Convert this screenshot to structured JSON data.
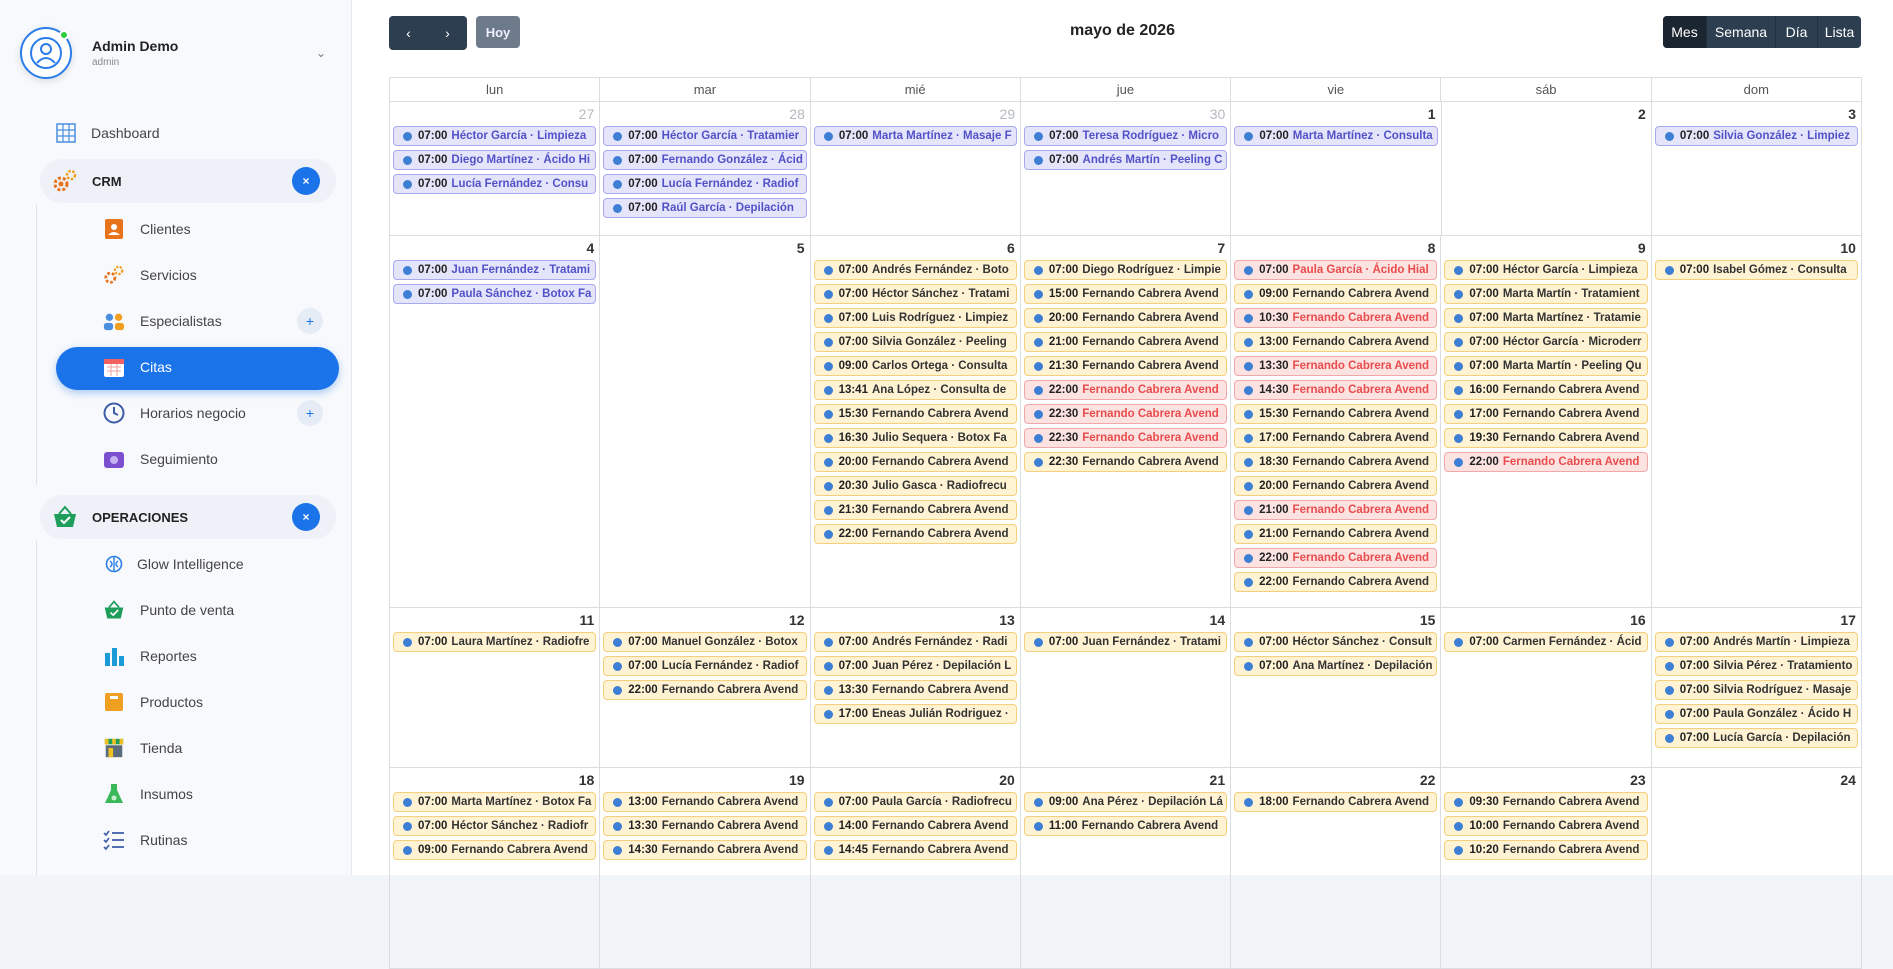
{
  "user": {
    "name": "Admin Demo",
    "role": "admin"
  },
  "nav": {
    "dashboard": "Dashboard",
    "crm_section": "CRM",
    "crm_items": [
      "Clientes",
      "Servicios",
      "Especialistas",
      "Citas",
      "Horarios negocio",
      "Seguimiento"
    ],
    "ops_section": "OPERACIONES",
    "ops_items": [
      "Glow Intelligence",
      "Punto de venta",
      "Reportes",
      "Productos",
      "Tienda",
      "Insumos",
      "Rutinas"
    ]
  },
  "toolbar": {
    "prev": "‹",
    "next": "›",
    "today": "Hoy",
    "title": "mayo de 2026",
    "views": [
      "Mes",
      "Semana",
      "Día",
      "Lista"
    ],
    "active_view": "Mes"
  },
  "weekdays": [
    "lun",
    "mar",
    "mié",
    "jue",
    "vie",
    "sáb",
    "dom"
  ],
  "weeks": [
    {
      "days": [
        {
          "n": "27",
          "other": true,
          "events": [
            {
              "time": "07:00",
              "text": "Héctor García · Limpieza",
              "kind": "purple"
            },
            {
              "time": "07:00",
              "text": "Diego Martínez · Ácido Hi",
              "kind": "purple"
            },
            {
              "time": "07:00",
              "text": "Lucía Fernández · Consu",
              "kind": "purple"
            }
          ]
        },
        {
          "n": "28",
          "other": true,
          "events": [
            {
              "time": "07:00",
              "text": "Héctor García · Tratamier",
              "kind": "purple"
            },
            {
              "time": "07:00",
              "text": "Fernando González · Ácid",
              "kind": "purple"
            },
            {
              "time": "07:00",
              "text": "Lucía Fernández · Radiof",
              "kind": "purple"
            },
            {
              "time": "07:00",
              "text": "Raúl García · Depilación",
              "kind": "purple"
            }
          ]
        },
        {
          "n": "29",
          "other": true,
          "events": [
            {
              "time": "07:00",
              "text": "Marta Martínez · Masaje F",
              "kind": "purple"
            }
          ]
        },
        {
          "n": "30",
          "other": true,
          "events": [
            {
              "time": "07:00",
              "text": "Teresa Rodríguez · Micro",
              "kind": "purple"
            },
            {
              "time": "07:00",
              "text": "Andrés Martín · Peeling C",
              "kind": "purple"
            }
          ]
        },
        {
          "n": "1",
          "events": [
            {
              "time": "07:00",
              "text": "Marta Martínez · Consulta",
              "kind": "purple"
            }
          ]
        },
        {
          "n": "2",
          "events": []
        },
        {
          "n": "3",
          "events": [
            {
              "time": "07:00",
              "text": "Silvia González · Limpiez",
              "kind": "purple"
            }
          ]
        }
      ]
    },
    {
      "days": [
        {
          "n": "4",
          "events": [
            {
              "time": "07:00",
              "text": "Juan Fernández · Tratami",
              "kind": "purple"
            },
            {
              "time": "07:00",
              "text": "Paula Sánchez · Botox Fa",
              "kind": "purple"
            }
          ]
        },
        {
          "n": "5",
          "events": []
        },
        {
          "n": "6",
          "events": [
            {
              "time": "07:00",
              "text": "Andrés Fernández · Boto",
              "kind": "yellow"
            },
            {
              "time": "07:00",
              "text": "Héctor Sánchez · Tratami",
              "kind": "yellow"
            },
            {
              "time": "07:00",
              "text": "Luis Rodríguez · Limpiez",
              "kind": "yellow"
            },
            {
              "time": "07:00",
              "text": "Silvia González · Peeling",
              "kind": "yellow"
            },
            {
              "time": "09:00",
              "text": "Carlos Ortega · Consulta",
              "kind": "yellow"
            },
            {
              "time": "13:41",
              "text": "Ana López · Consulta de",
              "kind": "yellow"
            },
            {
              "time": "15:30",
              "text": "Fernando Cabrera Avend",
              "kind": "yellow"
            },
            {
              "time": "16:30",
              "text": "Julio Sequera · Botox Fa",
              "kind": "yellow"
            },
            {
              "time": "20:00",
              "text": "Fernando Cabrera Avend",
              "kind": "yellow"
            },
            {
              "time": "20:30",
              "text": "Julio Gasca · Radiofrecu",
              "kind": "yellow"
            },
            {
              "time": "21:30",
              "text": "Fernando Cabrera Avend",
              "kind": "yellow"
            },
            {
              "time": "22:00",
              "text": "Fernando Cabrera Avend",
              "kind": "yellow"
            }
          ]
        },
        {
          "n": "7",
          "events": [
            {
              "time": "07:00",
              "text": "Diego Rodríguez · Limpie",
              "kind": "yellow"
            },
            {
              "time": "15:00",
              "text": "Fernando Cabrera Avend",
              "kind": "yellow"
            },
            {
              "time": "20:00",
              "text": "Fernando Cabrera Avend",
              "kind": "yellow"
            },
            {
              "time": "21:00",
              "text": "Fernando Cabrera Avend",
              "kind": "yellow"
            },
            {
              "time": "21:30",
              "text": "Fernando Cabrera Avend",
              "kind": "yellow"
            },
            {
              "time": "22:00",
              "text": "Fernando Cabrera Avend",
              "kind": "red"
            },
            {
              "time": "22:30",
              "text": "Fernando Cabrera Avend",
              "kind": "red"
            },
            {
              "time": "22:30",
              "text": "Fernando Cabrera Avend",
              "kind": "red"
            },
            {
              "time": "22:30",
              "text": "Fernando Cabrera Avend",
              "kind": "yellow"
            }
          ]
        },
        {
          "n": "8",
          "events": [
            {
              "time": "07:00",
              "text": "Paula García · Ácido Hial",
              "kind": "red"
            },
            {
              "time": "09:00",
              "text": "Fernando Cabrera Avend",
              "kind": "yellow"
            },
            {
              "time": "10:30",
              "text": "Fernando Cabrera Avend",
              "kind": "red"
            },
            {
              "time": "13:00",
              "text": "Fernando Cabrera Avend",
              "kind": "yellow"
            },
            {
              "time": "13:30",
              "text": "Fernando Cabrera Avend",
              "kind": "red"
            },
            {
              "time": "14:30",
              "text": "Fernando Cabrera Avend",
              "kind": "red"
            },
            {
              "time": "15:30",
              "text": "Fernando Cabrera Avend",
              "kind": "yellow"
            },
            {
              "time": "17:00",
              "text": "Fernando Cabrera Avend",
              "kind": "yellow"
            },
            {
              "time": "18:30",
              "text": "Fernando Cabrera Avend",
              "kind": "yellow"
            },
            {
              "time": "20:00",
              "text": "Fernando Cabrera Avend",
              "kind": "yellow"
            },
            {
              "time": "21:00",
              "text": "Fernando Cabrera Avend",
              "kind": "red"
            },
            {
              "time": "21:00",
              "text": "Fernando Cabrera Avend",
              "kind": "yellow"
            },
            {
              "time": "22:00",
              "text": "Fernando Cabrera Avend",
              "kind": "red"
            },
            {
              "time": "22:00",
              "text": "Fernando Cabrera Avend",
              "kind": "yellow"
            }
          ]
        },
        {
          "n": "9",
          "events": [
            {
              "time": "07:00",
              "text": "Héctor García · Limpieza",
              "kind": "yellow"
            },
            {
              "time": "07:00",
              "text": "Marta Martín · Tratamient",
              "kind": "yellow"
            },
            {
              "time": "07:00",
              "text": "Marta Martínez · Tratamie",
              "kind": "yellow"
            },
            {
              "time": "07:00",
              "text": "Héctor García · Microderr",
              "kind": "yellow"
            },
            {
              "time": "07:00",
              "text": "Marta Martín · Peeling Qu",
              "kind": "yellow"
            },
            {
              "time": "16:00",
              "text": "Fernando Cabrera Avend",
              "kind": "yellow"
            },
            {
              "time": "17:00",
              "text": "Fernando Cabrera Avend",
              "kind": "yellow"
            },
            {
              "time": "19:30",
              "text": "Fernando Cabrera Avend",
              "kind": "yellow"
            },
            {
              "time": "22:00",
              "text": "Fernando Cabrera Avend",
              "kind": "red"
            }
          ]
        },
        {
          "n": "10",
          "events": [
            {
              "time": "07:00",
              "text": "Isabel Gómez · Consulta",
              "kind": "yellow"
            }
          ]
        }
      ]
    },
    {
      "days": [
        {
          "n": "11",
          "events": [
            {
              "time": "07:00",
              "text": "Laura Martínez · Radiofre",
              "kind": "yellow"
            }
          ]
        },
        {
          "n": "12",
          "events": [
            {
              "time": "07:00",
              "text": "Manuel González · Botox",
              "kind": "yellow"
            },
            {
              "time": "07:00",
              "text": "Lucía Fernández · Radiof",
              "kind": "yellow"
            },
            {
              "time": "22:00",
              "text": "Fernando Cabrera Avend",
              "kind": "yellow"
            }
          ]
        },
        {
          "n": "13",
          "events": [
            {
              "time": "07:00",
              "text": "Andrés Fernández · Radi",
              "kind": "yellow"
            },
            {
              "time": "07:00",
              "text": "Juan Pérez · Depilación L",
              "kind": "yellow"
            },
            {
              "time": "13:30",
              "text": "Fernando Cabrera Avend",
              "kind": "yellow"
            },
            {
              "time": "17:00",
              "text": "Eneas Julián Rodriguez ·",
              "kind": "yellow"
            }
          ]
        },
        {
          "n": "14",
          "events": [
            {
              "time": "07:00",
              "text": "Juan Fernández · Tratami",
              "kind": "yellow"
            }
          ]
        },
        {
          "n": "15",
          "events": [
            {
              "time": "07:00",
              "text": "Héctor Sánchez · Consult",
              "kind": "yellow"
            },
            {
              "time": "07:00",
              "text": "Ana Martínez · Depilación",
              "kind": "yellow"
            }
          ]
        },
        {
          "n": "16",
          "events": [
            {
              "time": "07:00",
              "text": "Carmen Fernández · Ácid",
              "kind": "yellow"
            }
          ]
        },
        {
          "n": "17",
          "events": [
            {
              "time": "07:00",
              "text": "Andrés Martín · Limpieza",
              "kind": "yellow"
            },
            {
              "time": "07:00",
              "text": "Silvia Pérez · Tratamiento",
              "kind": "yellow"
            },
            {
              "time": "07:00",
              "text": "Silvia Rodríguez · Masaje",
              "kind": "yellow"
            },
            {
              "time": "07:00",
              "text": "Paula González · Ácido H",
              "kind": "yellow"
            },
            {
              "time": "07:00",
              "text": "Lucía García · Depilación",
              "kind": "yellow"
            }
          ]
        }
      ]
    },
    {
      "days": [
        {
          "n": "18",
          "events": [
            {
              "time": "07:00",
              "text": "Marta Martínez · Botox Fa",
              "kind": "yellow"
            },
            {
              "time": "07:00",
              "text": "Héctor Sánchez · Radiofr",
              "kind": "yellow"
            },
            {
              "time": "09:00",
              "text": "Fernando Cabrera Avend",
              "kind": "yellow"
            }
          ]
        },
        {
          "n": "19",
          "events": [
            {
              "time": "13:00",
              "text": "Fernando Cabrera Avend",
              "kind": "yellow"
            },
            {
              "time": "13:30",
              "text": "Fernando Cabrera Avend",
              "kind": "yellow"
            },
            {
              "time": "14:30",
              "text": "Fernando Cabrera Avend",
              "kind": "yellow"
            }
          ]
        },
        {
          "n": "20",
          "events": [
            {
              "time": "07:00",
              "text": "Paula García · Radiofrecu",
              "kind": "yellow"
            },
            {
              "time": "14:00",
              "text": "Fernando Cabrera Avend",
              "kind": "yellow"
            },
            {
              "time": "14:45",
              "text": "Fernando Cabrera Avend",
              "kind": "yellow"
            }
          ]
        },
        {
          "n": "21",
          "events": [
            {
              "time": "09:00",
              "text": "Ana Pérez · Depilación Lá",
              "kind": "yellow"
            },
            {
              "time": "11:00",
              "text": "Fernando Cabrera Avend",
              "kind": "yellow"
            }
          ]
        },
        {
          "n": "22",
          "events": [
            {
              "time": "18:00",
              "text": "Fernando Cabrera Avend",
              "kind": "yellow"
            }
          ]
        },
        {
          "n": "23",
          "events": [
            {
              "time": "09:30",
              "text": "Fernando Cabrera Avend",
              "kind": "yellow"
            },
            {
              "time": "10:00",
              "text": "Fernando Cabrera Avend",
              "kind": "yellow"
            },
            {
              "time": "10:20",
              "text": "Fernando Cabrera Avend",
              "kind": "yellow"
            }
          ]
        },
        {
          "n": "24",
          "events": []
        }
      ]
    }
  ]
}
